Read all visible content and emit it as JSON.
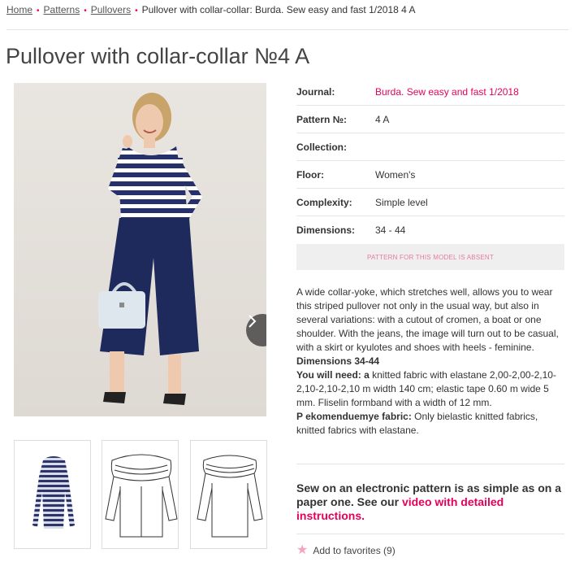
{
  "breadcrumb": {
    "items": [
      "Home",
      "Patterns",
      "Pullovers"
    ],
    "current": "Pullover with collar-collar: Burda. Sew easy and fast 1/2018 4 A"
  },
  "page_title": "Pullover with collar-collar №4 A",
  "specs": [
    {
      "label": "Journal:",
      "value": "Burda. Sew easy and fast 1/2018"
    },
    {
      "label": "Pattern №:",
      "value": "4 A"
    },
    {
      "label": "Collection:",
      "value": ""
    },
    {
      "label": "Floor:",
      "value": "Women's"
    },
    {
      "label": "Complexity:",
      "value": "Simple level"
    },
    {
      "label": "Dimensions:",
      "value": "34 - 44"
    }
  ],
  "absent_notice": "PATTERN FOR THIS MODEL IS ABSENT",
  "description": {
    "intro": "A wide collar-yoke, which stretches well, allows you to wear this striped pullover not only in the usual way, but also in several variations: with a cutout of cromen, a boat or one shoulder. With the jeans, the image will turn out to be casual, with a skirt or kyulotes and shoes with heels - feminine.",
    "dimensions": "Dimensions 34-44",
    "need_label": "You will need: a",
    "need_text": " knitted fabric with elastane 2,00-2,00-2,10-2,10-2,10-2,10 m width 140 cm; elastic tape 0.60 m wide 5 mm. Fliselin formband with a width of 12 mm.",
    "fabric_label": "P ekomenduemye fabric:",
    "fabric_text": " Only bielastic knitted fabrics, knitted fabrics with elastane."
  },
  "promo": {
    "text": "Sew on an electronic pattern is as simple as on a paper one. See our ",
    "link": "video with detailed instructions."
  },
  "favorites": {
    "label": "Add to favorites (9)"
  },
  "colors": {
    "accent": "#e5005b",
    "navy": "#1f2a5c"
  },
  "icons": {
    "next": "chevron-right-icon",
    "favorite": "star-icon"
  }
}
